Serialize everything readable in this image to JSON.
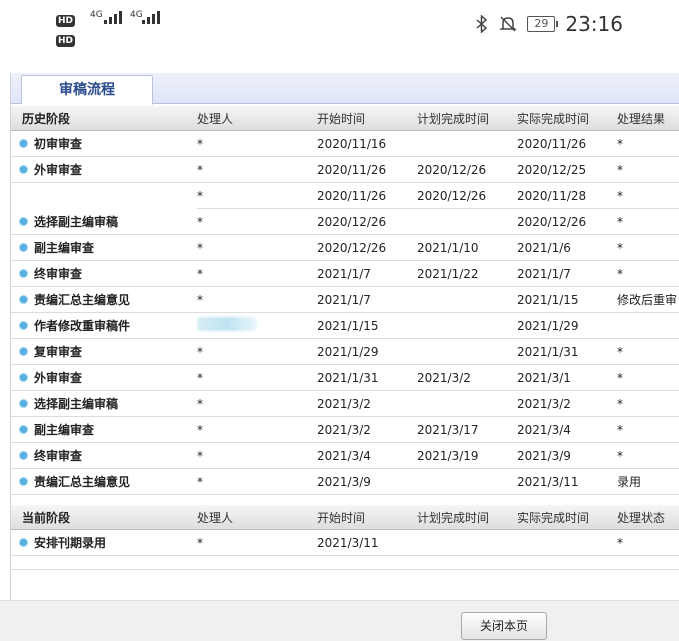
{
  "status_bar": {
    "left_badges": [
      "HD",
      "HD"
    ],
    "network_1": "4G",
    "network_2": "4G",
    "battery": "29",
    "time": "23:16"
  },
  "tab": {
    "label": "审稿流程"
  },
  "history": {
    "headers": [
      "历史阶段",
      "处理人",
      "开始时间",
      "计划完成时间",
      "实际完成时间",
      "处理结果"
    ],
    "rows": [
      {
        "stage": "初审审查",
        "handler": "*",
        "start": "2020/11/16",
        "planned": "",
        "actual": "2020/11/26",
        "result": "*"
      },
      {
        "stage": "外审审查",
        "handler": "*",
        "start": "2020/11/26",
        "planned": "2020/12/26",
        "actual": "2020/12/25",
        "result": "*"
      },
      {
        "stage": "",
        "handler": "*",
        "start": "2020/11/26",
        "planned": "2020/12/26",
        "actual": "2020/11/28",
        "result": "*"
      },
      {
        "stage": "选择副主编审稿",
        "handler": "*",
        "start": "2020/12/26",
        "planned": "",
        "actual": "2020/12/26",
        "result": "*"
      },
      {
        "stage": "副主编审查",
        "handler": "*",
        "start": "2020/12/26",
        "planned": "2021/1/10",
        "actual": "2021/1/6",
        "result": "*"
      },
      {
        "stage": "终审审查",
        "handler": "*",
        "start": "2021/1/7",
        "planned": "2021/1/22",
        "actual": "2021/1/7",
        "result": "*"
      },
      {
        "stage": "责编汇总主编意见",
        "handler": "*",
        "start": "2021/1/7",
        "planned": "",
        "actual": "2021/1/15",
        "result": "修改后重审"
      },
      {
        "stage": "作者修改重审稿件",
        "handler": "",
        "start": "2021/1/15",
        "planned": "",
        "actual": "2021/1/29",
        "result": ""
      },
      {
        "stage": "复审审查",
        "handler": "*",
        "start": "2021/1/29",
        "planned": "",
        "actual": "2021/1/31",
        "result": "*"
      },
      {
        "stage": "外审审查",
        "handler": "*",
        "start": "2021/1/31",
        "planned": "2021/3/2",
        "actual": "2021/3/1",
        "result": "*"
      },
      {
        "stage": "选择副主编审稿",
        "handler": "*",
        "start": "2021/3/2",
        "planned": "",
        "actual": "2021/3/2",
        "result": "*"
      },
      {
        "stage": "副主编审查",
        "handler": "*",
        "start": "2021/3/2",
        "planned": "2021/3/17",
        "actual": "2021/3/4",
        "result": "*"
      },
      {
        "stage": "终审审查",
        "handler": "*",
        "start": "2021/3/4",
        "planned": "2021/3/19",
        "actual": "2021/3/9",
        "result": "*"
      },
      {
        "stage": "责编汇总主编意见",
        "handler": "*",
        "start": "2021/3/9",
        "planned": "",
        "actual": "2021/3/11",
        "result": "录用"
      }
    ]
  },
  "current": {
    "headers": [
      "当前阶段",
      "处理人",
      "开始时间",
      "计划完成时间",
      "实际完成时间",
      "处理状态"
    ],
    "rows": [
      {
        "stage": "安排刊期录用",
        "handler": "*",
        "start": "2021/3/11",
        "planned": "",
        "actual": "",
        "result": "*"
      }
    ]
  },
  "footer": {
    "close_label": "关闭本页"
  },
  "colors": {
    "tab_text": "#2b4c8c",
    "bullet": "#57b0e0",
    "tab_bar": "#dfe5f7"
  }
}
